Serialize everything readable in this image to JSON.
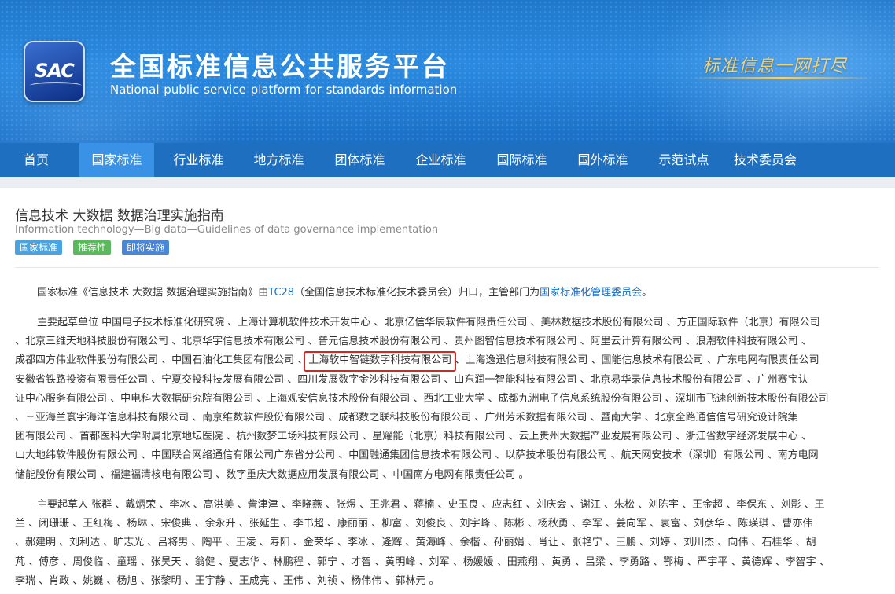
{
  "header": {
    "logo_text": "SAC",
    "title": "全国标准信息公共服务平台",
    "subtitle": "National public service platform  for standards information",
    "slogan": "标准信息一网打尽"
  },
  "nav": {
    "items": [
      {
        "label": "首页",
        "active": false
      },
      {
        "label": "国家标准",
        "active": true
      },
      {
        "label": "行业标准",
        "active": false
      },
      {
        "label": "地方标准",
        "active": false
      },
      {
        "label": "团体标准",
        "active": false
      },
      {
        "label": "企业标准",
        "active": false
      },
      {
        "label": "国际标准",
        "active": false
      },
      {
        "label": "国外标准",
        "active": false
      },
      {
        "label": "示范试点",
        "active": false
      },
      {
        "label": "技术委员会",
        "active": false
      }
    ]
  },
  "standard": {
    "title": "信息技术 大数据 数据治理实施指南",
    "title_en": "Information technology—Big data—Guidelines of data governance implementation",
    "badges": [
      {
        "label": "国家标准",
        "color": "#4aa3df"
      },
      {
        "label": "推荐性",
        "color": "#5cb85c"
      },
      {
        "label": "即将实施",
        "color": "#4a86d8"
      }
    ]
  },
  "intro": {
    "prefix": "国家标准《信息技术 大数据 数据治理实施指南》由",
    "tc_link": "TC28",
    "middle": "（全国信息技术标准化技术委员会）归口，主管部门为",
    "dept_link": "国家标准化管理委员会",
    "suffix": "。"
  },
  "drafting_units": {
    "lines": [
      "主要起草单位 中国电子技术标准化研究院 、上海计算机软件技术开发中心 、北京亿信华辰软件有限责任公司 、美林数据技术股份有限公司 、方正国际软件（北京）有限公司",
      "、北京三维天地科技股份有限公司 、北京华宇信息技术有限公司 、普元信息技术股份有限公司 、贵州图智信息技术有限公司 、阿里云计算有限公司 、浪潮软件科技有限公司 、",
      "成都四方伟业软件股份有限公司 、中国石油化工集团有限公司 、",
      "安徽省铁路投资有限责任公司 、宁夏交投科技发展有限公司 、四川发展数字金沙科技有限公司 、山东润一智能科技有限公司 、北京易华录信息技术股份有限公司 、广州赛宝认",
      "证中心服务有限公司 、中电科大数据研究院有限公司 、上海观安信息技术股份有限公司 、西北工业大学 、成都九洲电子信息系统股份有限公司 、深圳市飞速创新技术股份有限公司",
      "、三亚海兰寰宇海洋信息科技有限公司 、南京维数软件股份有限公司 、成都数之联科技股份有限公司 、广州芳禾数据有限公司 、暨南大学 、北京全路通信信号研究设计院集",
      "团有限公司 、首都医科大学附属北京地坛医院 、杭州数梦工场科技有限公司 、星耀能（北京）科技有限公司 、云上贵州大数据产业发展有限公司 、浙江省数字经济发展中心 、",
      "山大地纬软件股份有限公司 、中国联合网络通信有限公司广东省分公司 、中国融通集团信息技术有限公司 、以萨技术股份有限公司 、航天网安技术（深圳）有限公司 、南方电网",
      "储能股份有限公司 、福建福清核电有限公司 、数字重庆大数据应用发展有限公司 、中国南方电网有限责任公司 。"
    ],
    "highlighted": "上海软中智链数字科技有限公司",
    "line3_tail": " 、上海逸迅信息科技有限公司 、国能信息技术有限公司 、广东电网有限责任公司"
  },
  "drafters": {
    "lines": [
      "主要起草人 张群 、戴炳荣 、李冰 、高洪美 、訾津津 、李晓燕 、张煜 、王兆君 、蒋楠 、史玉良 、应志红 、刘庆会 、谢江 、朱松 、刘陈宇 、王金超 、李保东 、刘影 、王",
      "兰 、闭珊珊 、王红梅 、杨琳 、宋俊典 、余永升 、张延生 、李书超 、康丽丽 、柳富 、刘俊良 、刘宇峰 、陈彬 、杨秋勇 、李军 、姜向军 、袁富 、刘彦华 、陈瑛琪 、曹亦伟",
      "、郝建明 、刘利达 、旷志光 、吕将男 、陶平 、王凌 、寿阳 、金荣华 、李冰 、逄辉 、黄海峰 、余楷 、孙丽娟 、肖让 、张艳宁 、王鹏 、刘婷 、刘川杰 、向伟 、石桂华 、胡",
      "芃 、傅彦 、周俊临 、童瑶 、张昊天 、翁健 、夏志华 、林鹏程 、郭宁 、才智 、黄明峰 、刘军 、杨媛媛 、田燕翔 、黄勇 、吕梁 、李勇路 、鄂梅 、严宇平 、黄德辉 、李智宇 、",
      "李瑞 、肖政 、姚巍 、杨旭 、张黎明 、王宇静 、王成亮 、王伟 、刘祯 、杨伟伟 、郭林元 。"
    ]
  }
}
